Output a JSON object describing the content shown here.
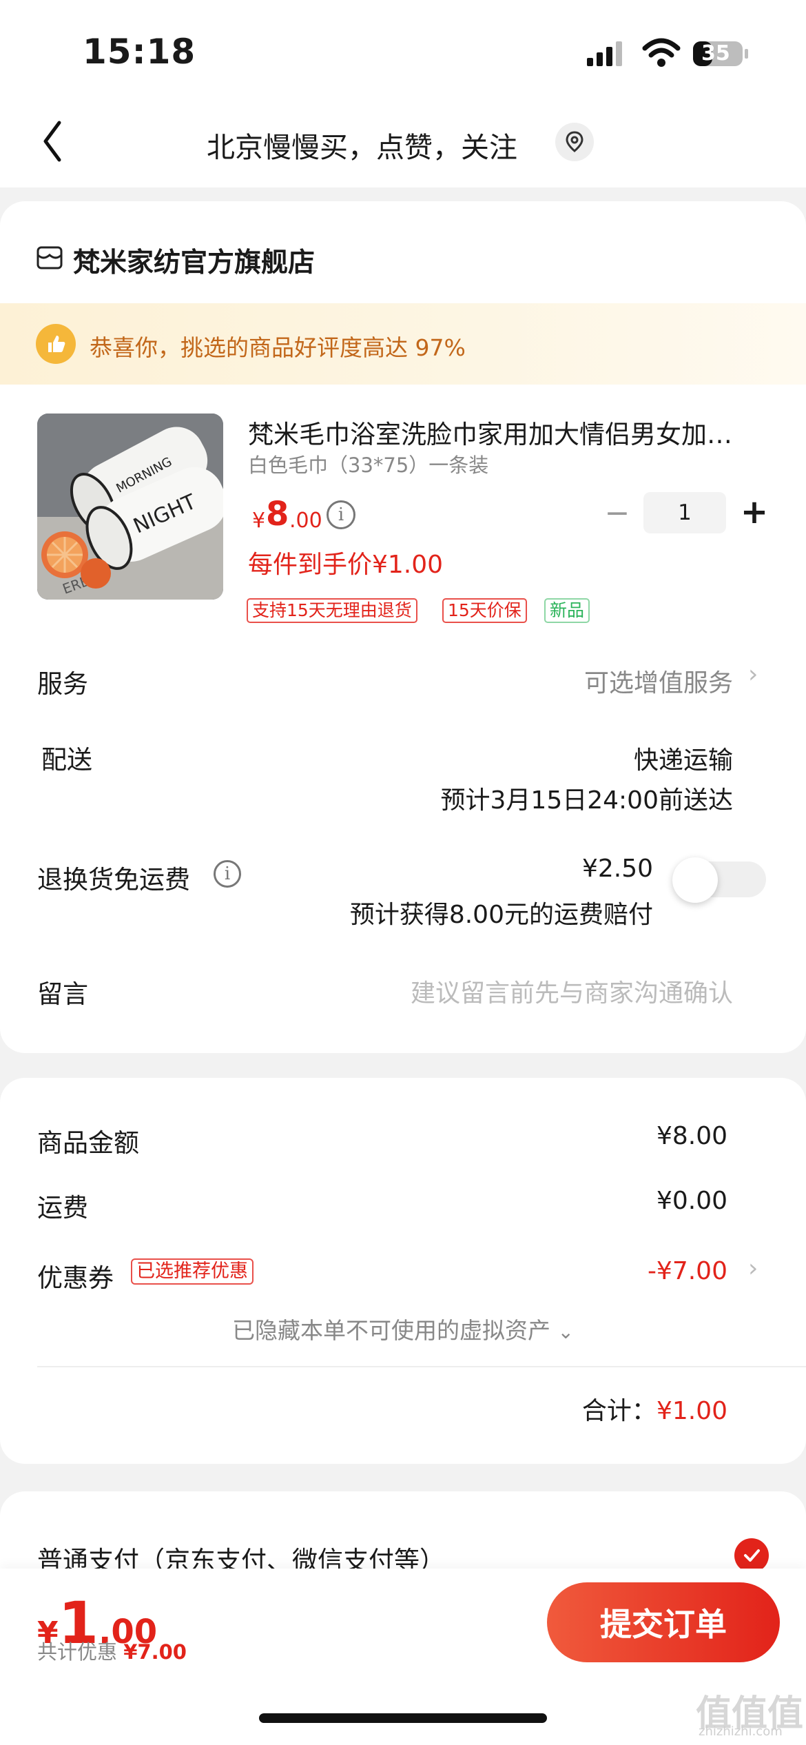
{
  "status_bar": {
    "time": "15:18",
    "battery": "35"
  },
  "nav": {
    "title": "北京慢慢买，点赞，关注"
  },
  "store": {
    "name": "梵米家纺官方旗舰店"
  },
  "banner": {
    "text": "恭喜你，挑选的商品好评度高达 97%"
  },
  "product": {
    "title": "梵米毛巾浴室洗脸巾家用加大情侣男女加…",
    "spec": "白色毛巾（33*75）一条装",
    "price_symbol": "¥",
    "price_int": "8",
    "price_dec": ".00",
    "unit_price": "每件到手价¥1.00",
    "quantity": "1",
    "image_text": [
      "MORNING",
      "NIGHT",
      "EREAL"
    ],
    "tags": [
      "支持15天无理由退货",
      "15天价保",
      "新品"
    ]
  },
  "qty_controls": {
    "minus": "−",
    "plus": "+"
  },
  "service": {
    "label": "服务",
    "value": "可选增值服务"
  },
  "delivery": {
    "label": "配送",
    "method": "快递运输",
    "eta": "预计3月15日24:00前送达"
  },
  "return_shipping": {
    "label": "退换货免运费",
    "price": "¥2.50",
    "note": "预计获得8.00元的运费赔付",
    "enabled": false
  },
  "message": {
    "label": "留言",
    "placeholder": "建议留言前先与商家沟通确认"
  },
  "summary": {
    "goods_label": "商品金额",
    "goods_value": "¥8.00",
    "shipping_label": "运费",
    "shipping_value": "¥0.00",
    "coupon_label": "优惠券",
    "coupon_badge": "已选推荐优惠",
    "coupon_value": "-¥7.00",
    "hidden_assets": "已隐藏本单不可使用的虚拟资产",
    "total_label": "合计：",
    "total_value": "¥1.00"
  },
  "payment": {
    "method": "普通支付（京东支付、微信支付等）"
  },
  "bottom": {
    "price_symbol": "¥",
    "price_int": "1",
    "price_dec": ".00",
    "discount_label": "共计优惠",
    "discount_value": "¥7.00",
    "submit": "提交订单"
  },
  "watermark": {
    "text": "值值值",
    "sub": "zhizhizhi.com"
  },
  "colors": {
    "accent": "#e2231a",
    "banner_text": "#c2671a",
    "banner_bg": "#fdf1d6"
  }
}
